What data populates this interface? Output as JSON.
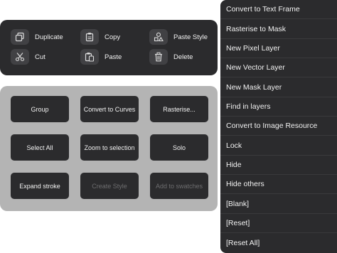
{
  "quick_actions": {
    "duplicate": "Duplicate",
    "copy": "Copy",
    "paste_style": "Paste Style",
    "cut": "Cut",
    "paste": "Paste",
    "delete": "Delete"
  },
  "layer_actions": {
    "group": "Group",
    "convert_to_curves": "Convert to Curves",
    "rasterise": "Rasterise...",
    "select_all": "Select All",
    "zoom_to_selection": "Zoom to selection",
    "solo": "Solo",
    "expand_stroke": "Expand stroke",
    "create_style": "Create Style",
    "add_to_swatches": "Add to swatches"
  },
  "context_menu": {
    "items": [
      "Convert to Text Frame",
      "Rasterise to Mask",
      "New Pixel Layer",
      "New Vector Layer",
      "New Mask Layer",
      "Find in layers",
      "Convert to Image Resource",
      "Lock",
      "Hide",
      "Hide others",
      "[Blank]",
      "[Reset]",
      "[Reset All]"
    ]
  },
  "icons": {
    "duplicate": "duplicate-icon",
    "copy": "clipboard-icon",
    "paste_style": "shapes-icon",
    "cut": "scissors-icon",
    "paste": "paste-icon",
    "delete": "trash-icon"
  },
  "colors": {
    "panel": "#2b2b2d",
    "grid_background": "#b4b4b4",
    "disabled_text": "#6d6d6f"
  }
}
